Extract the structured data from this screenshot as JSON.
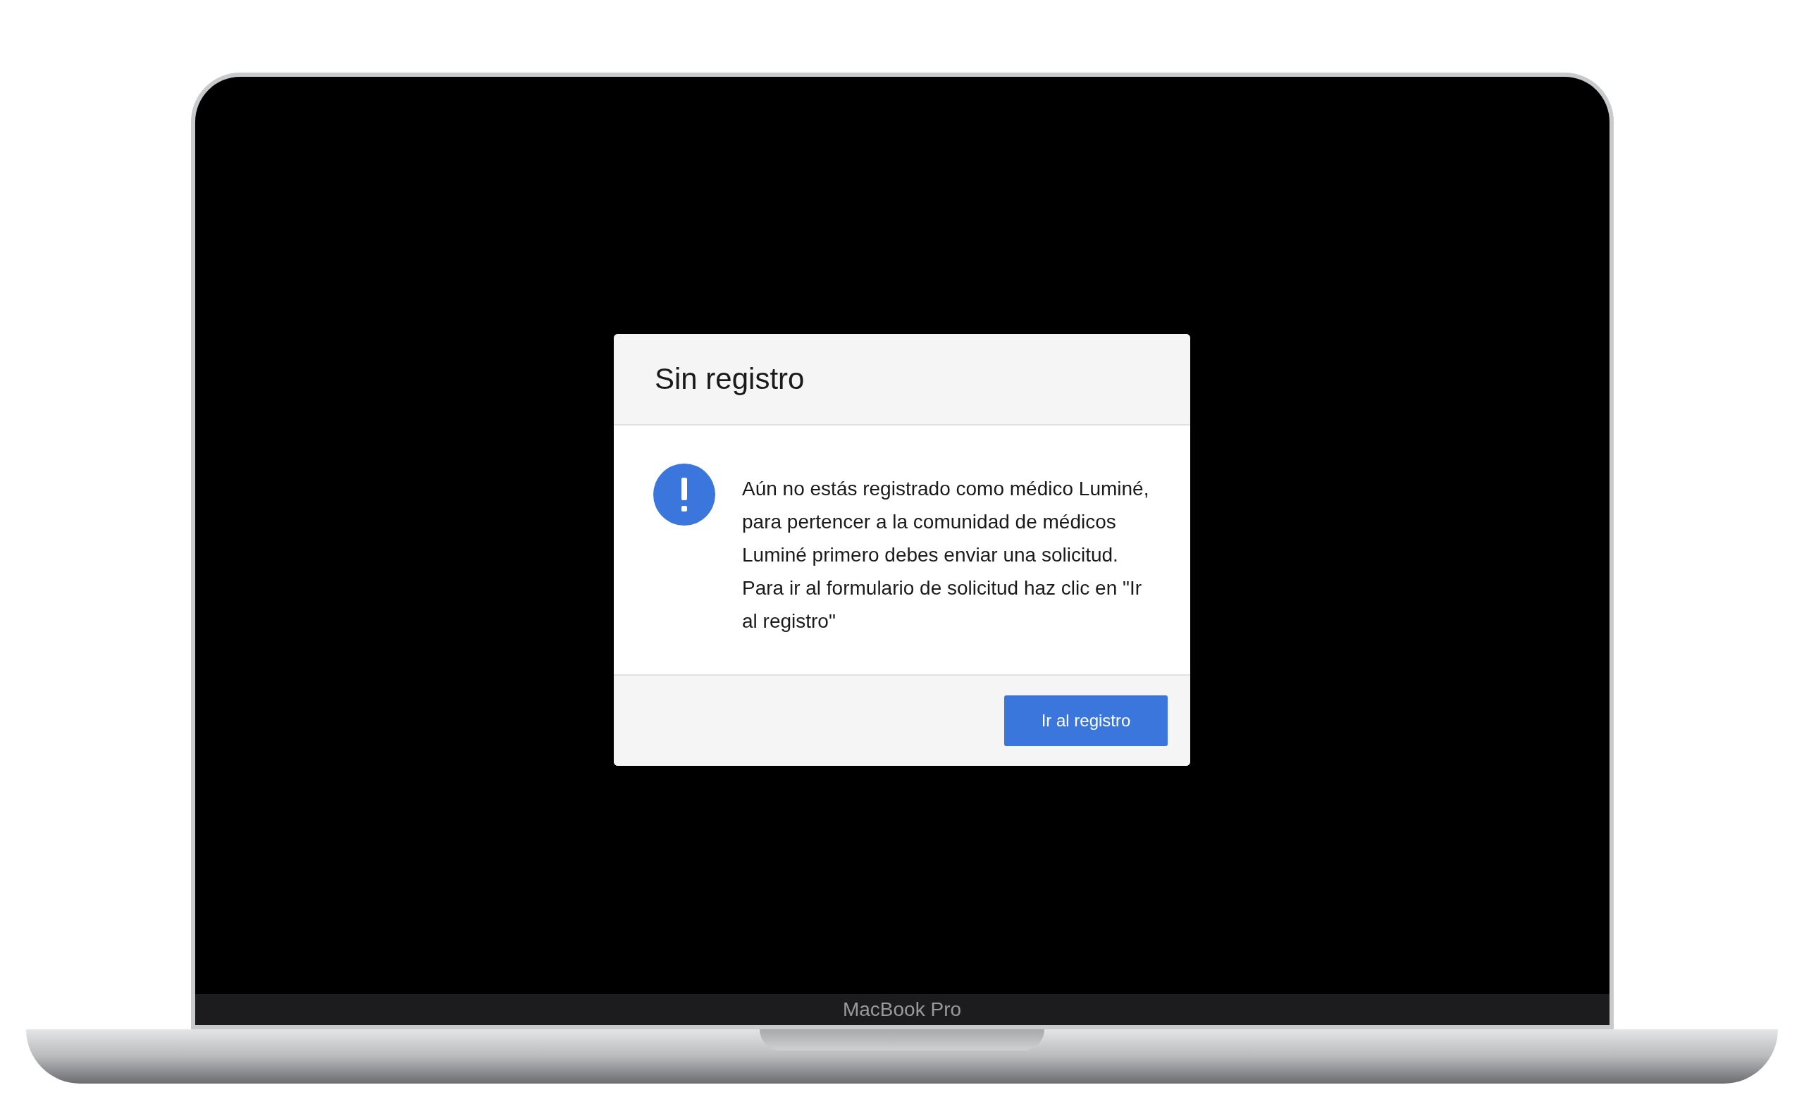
{
  "dialog": {
    "title": "Sin registro",
    "message": "Aún no estás registrado como médico Luminé, para pertencer a la comunidad de médicos Luminé primero debes enviar una solicitud. Para ir al formulario de solicitud haz clic en \"Ir al registro\"",
    "button": "Ir al registro"
  },
  "device_label": "MacBook Pro"
}
